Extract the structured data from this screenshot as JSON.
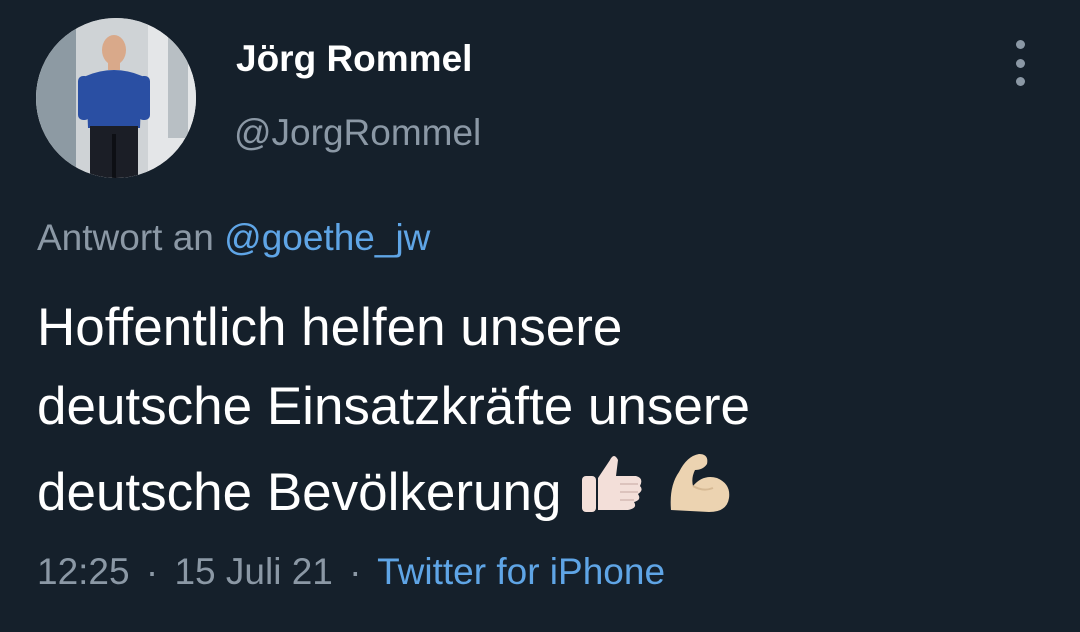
{
  "author": {
    "display_name": "Jörg Rommel",
    "handle": "@JorgRommel",
    "avatar_icon": "profile-photo"
  },
  "menu": {
    "icon": "more-vertical-icon"
  },
  "reply": {
    "prefix": "Antwort an",
    "handle": "@goethe_jw"
  },
  "tweet": {
    "line1": "Hoffentlich helfen unsere",
    "line2": "deutsche Einsatzkräfte unsere",
    "line3": "deutsche Bevölkerung",
    "emojis": [
      "thumbs-up-icon",
      "flexed-biceps-icon"
    ]
  },
  "meta": {
    "time": "12:25",
    "dot1": "·",
    "date": "15 Juli 21",
    "dot2": "·",
    "source": "Twitter for iPhone"
  },
  "colors": {
    "background": "#15202b",
    "text": "#ffffff",
    "secondary": "#8b98a5",
    "link": "#5fa5e6"
  }
}
